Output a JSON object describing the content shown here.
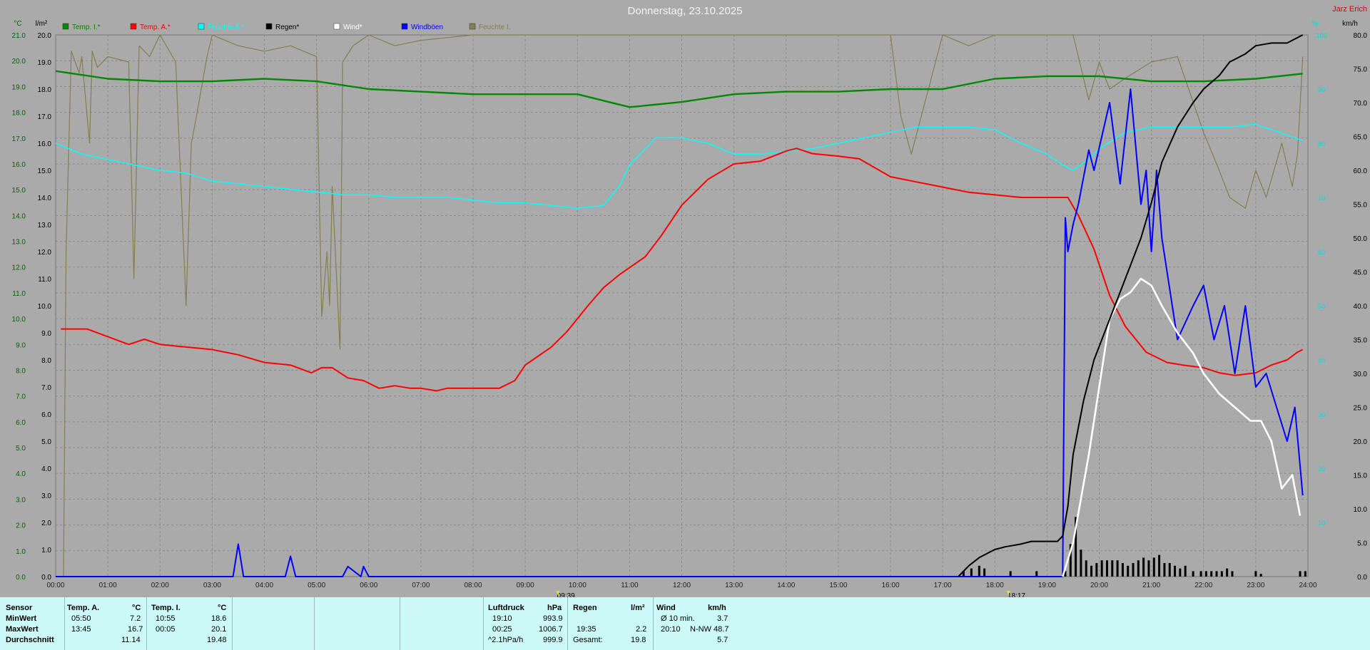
{
  "header": {
    "title": "Donnerstag, 23.10.2025",
    "station": "Jarz Erich"
  },
  "colors": {
    "background": "#aaaaaa",
    "grid": "#8c8c8c",
    "left_axis": "#008800",
    "right_axis": "#00dddd",
    "table_bg": "#ccfaf8"
  },
  "chart_data": {
    "type": "line",
    "axes": {
      "left_unit": "°C",
      "left2_unit": "l/m²",
      "right_unit": "km/h",
      "right2_unit": "%",
      "temp_ticks": [
        "21.0",
        "20.0",
        "19.0",
        "18.0",
        "17.0",
        "16.0",
        "15.0",
        "14.0",
        "13.0",
        "12.0",
        "11.0",
        "10.0",
        "9.0",
        "8.0",
        "7.0",
        "6.0",
        "5.0",
        "4.0",
        "3.0",
        "2.0",
        "1.0",
        "0.0"
      ],
      "rain_ticks": [
        "20.0",
        "19.0",
        "18.0",
        "17.0",
        "16.0",
        "15.0",
        "14.0",
        "13.0",
        "12.0",
        "11.0",
        "10.0",
        "9.0",
        "8.0",
        "7.0",
        "6.0",
        "5.0",
        "4.0",
        "3.0",
        "2.0",
        "1.0",
        "0.0"
      ],
      "wind_ticks": [
        "80.0",
        "75.0",
        "70.0",
        "65.0",
        "60.0",
        "55.0",
        "50.0",
        "45.0",
        "40.0",
        "35.0",
        "30.0",
        "25.0",
        "20.0",
        "15.0",
        "10.0",
        "5.0",
        "0.0"
      ],
      "humidity_ticks": [
        "100",
        "90",
        "80",
        "70",
        "60",
        "50",
        "40",
        "30",
        "20",
        "10"
      ],
      "x_ticks": [
        "00:00",
        "01:00",
        "02:00",
        "03:00",
        "04:00",
        "05:00",
        "06:00",
        "07:00",
        "08:00",
        "09:00",
        "10:00",
        "11:00",
        "12:00",
        "13:00",
        "14:00",
        "15:00",
        "16:00",
        "17:00",
        "18:00",
        "19:00",
        "20:00",
        "21:00",
        "22:00",
        "23:00",
        "24:00"
      ],
      "temp_range": [
        0,
        21
      ],
      "rain_range": [
        0,
        20
      ],
      "wind_range": [
        0,
        80
      ],
      "humidity_range": [
        0,
        100
      ],
      "x_range": [
        0,
        24
      ],
      "grid": true,
      "markers": [
        "09:39",
        "18:17"
      ]
    },
    "legend": [
      {
        "label": "Temp. I.*",
        "color": "#008800"
      },
      {
        "label": "Temp. A.*",
        "color": "#ff0000"
      },
      {
        "label": "Feuchte A.*",
        "color": "#00ffff"
      },
      {
        "label": "Regen*",
        "color": "#000000"
      },
      {
        "label": "Wind*",
        "color": "#ffffff"
      },
      {
        "label": "Windböen",
        "color": "#0000ff"
      },
      {
        "label": "Feuchte I.",
        "color": "#808050"
      }
    ],
    "series": [
      {
        "name": "Temp. I.*",
        "unit": "°C",
        "color": "#008800",
        "x": [
          0,
          1,
          2,
          3,
          4,
          5,
          6,
          7,
          8,
          9,
          10,
          11,
          12,
          13,
          14,
          15,
          16,
          17,
          18,
          19,
          20,
          21,
          22,
          23,
          23.9
        ],
        "y": [
          19.6,
          19.3,
          19.2,
          19.2,
          19.3,
          19.2,
          18.9,
          18.8,
          18.7,
          18.7,
          18.7,
          18.2,
          18.4,
          18.7,
          18.8,
          18.8,
          18.9,
          18.9,
          19.3,
          19.4,
          19.4,
          19.2,
          19.2,
          19.3,
          19.5
        ]
      },
      {
        "name": "Temp. A.*",
        "unit": "°C",
        "color": "#ff0000",
        "x": [
          0.1,
          0.6,
          1,
          1.4,
          1.7,
          2,
          2.5,
          3,
          3.5,
          4,
          4.5,
          4.9,
          5.1,
          5.3,
          5.6,
          5.9,
          6.2,
          6.5,
          6.8,
          7,
          7.3,
          7.5,
          8,
          8.5,
          8.8,
          9,
          9.5,
          9.8,
          10.2,
          10.5,
          10.8,
          11.3,
          11.6,
          12,
          12.5,
          13,
          13.5,
          14,
          14.2,
          14.5,
          15,
          15.4,
          16,
          16.5,
          17,
          17.5,
          18,
          18.5,
          19,
          19.4,
          19.6,
          19.9,
          20.2,
          20.5,
          20.9,
          21.3,
          21.6,
          22,
          22.3,
          22.6,
          23,
          23.3,
          23.6,
          23.8,
          23.9
        ],
        "y": [
          9.6,
          9.6,
          9.3,
          9.0,
          9.2,
          9.0,
          8.9,
          8.8,
          8.6,
          8.3,
          8.2,
          7.9,
          8.1,
          8.1,
          7.7,
          7.6,
          7.3,
          7.4,
          7.3,
          7.3,
          7.2,
          7.3,
          7.3,
          7.3,
          7.6,
          8.2,
          8.9,
          9.5,
          10.5,
          11.2,
          11.7,
          12.4,
          13.2,
          14.4,
          15.4,
          16.0,
          16.1,
          16.5,
          16.6,
          16.4,
          16.3,
          16.2,
          15.5,
          15.3,
          15.1,
          14.9,
          14.8,
          14.7,
          14.7,
          14.7,
          14.0,
          12.7,
          10.9,
          9.7,
          8.7,
          8.3,
          8.2,
          8.1,
          7.9,
          7.8,
          7.9,
          8.2,
          8.4,
          8.7,
          8.8
        ]
      },
      {
        "name": "Feuchte A.*",
        "unit": "%",
        "color": "#00ffff",
        "x": [
          0,
          0.5,
          1,
          1.5,
          2,
          2.5,
          3,
          3.5,
          4,
          4.5,
          5,
          5.5,
          6,
          6.5,
          7,
          7.5,
          8,
          8.5,
          9,
          9.5,
          10,
          10.5,
          10.8,
          11,
          11.5,
          12,
          12.5,
          13,
          13.5,
          14,
          14.5,
          15,
          15.5,
          16,
          16.5,
          17,
          17.5,
          18,
          18.5,
          19,
          19.3,
          19.5,
          19.8,
          20,
          20.5,
          21,
          21.5,
          22,
          22.5,
          23,
          23.3,
          23.6,
          23.9
        ],
        "y": [
          80,
          78,
          77,
          76,
          75,
          74.5,
          73,
          72.5,
          72,
          71.5,
          71,
          70.5,
          70.5,
          70,
          70,
          70,
          69.5,
          69,
          69,
          68.5,
          68,
          68.5,
          72,
          76,
          81,
          81,
          80,
          78,
          78,
          78.5,
          79,
          80,
          81,
          82,
          83,
          83,
          83,
          82.5,
          80,
          78,
          76,
          75,
          77,
          79,
          82,
          83,
          83,
          83,
          83,
          83.5,
          82.5,
          81.5,
          80.5
        ]
      },
      {
        "name": "Regen*",
        "unit": "l/m²",
        "color": "#000000",
        "x": [
          17.3,
          17.5,
          17.7,
          17.9,
          18,
          18.2,
          18.5,
          18.7,
          19,
          19.2,
          19.3,
          19.4,
          19.5,
          19.7,
          19.9,
          20.2,
          20.5,
          20.8,
          21,
          21.2,
          21.5,
          21.8,
          22,
          22.3,
          22.5,
          22.8,
          23,
          23.3,
          23.6,
          23.9
        ],
        "y": [
          0,
          0.4,
          0.7,
          0.9,
          1,
          1.1,
          1.2,
          1.3,
          1.3,
          1.3,
          1.5,
          2.6,
          4.5,
          6.5,
          8,
          9.5,
          11,
          12.5,
          13.8,
          15.3,
          16.6,
          17.5,
          18,
          18.5,
          19,
          19.3,
          19.6,
          19.7,
          19.7,
          20.0
        ]
      },
      {
        "name": "Wind*",
        "unit": "km/h",
        "color": "#ffffff",
        "x": [
          19.3,
          19.5,
          19.8,
          20,
          20.2,
          20.4,
          20.6,
          20.8,
          21,
          21.2,
          21.5,
          21.8,
          22,
          22.3,
          22.6,
          22.9,
          23.1,
          23.3,
          23.5,
          23.7,
          23.85
        ],
        "y": [
          0,
          5,
          18,
          28,
          38,
          41,
          42,
          44,
          43,
          40,
          36,
          33,
          30,
          27,
          25,
          23,
          23,
          20,
          13,
          15,
          9
        ]
      },
      {
        "name": "Windböen",
        "unit": "km/h",
        "color": "#0000ff",
        "x": [
          0,
          3.4,
          3.5,
          3.6,
          4.4,
          4.5,
          4.6,
          5.5,
          5.6,
          5.85,
          5.9,
          6,
          19.3,
          19.35,
          19.4,
          19.5,
          19.6,
          19.8,
          19.9,
          20.2,
          20.4,
          20.6,
          20.8,
          20.9,
          21,
          21.1,
          21.2,
          21.5,
          21.8,
          22,
          22.2,
          22.4,
          22.6,
          22.8,
          23,
          23.2,
          23.4,
          23.6,
          23.75,
          23.9
        ],
        "y": [
          0,
          0,
          4.8,
          0,
          0,
          3,
          0,
          0,
          1.5,
          0,
          1.5,
          0,
          0,
          53,
          48,
          52,
          55,
          63,
          60,
          70,
          58,
          72,
          55,
          60,
          48,
          60,
          50,
          35,
          40,
          43,
          35,
          40,
          30,
          40,
          28,
          30,
          25,
          20,
          25,
          12
        ]
      },
      {
        "name": "Feuchte I.",
        "unit": "%",
        "color": "#808050",
        "x": [
          0.15,
          0.2,
          0.3,
          0.45,
          0.5,
          0.65,
          0.7,
          0.8,
          1,
          1.4,
          1.5,
          1.6,
          1.8,
          2,
          2.3,
          2.5,
          2.6,
          2.7,
          2.9,
          3,
          3.5,
          4,
          4.5,
          5,
          5.1,
          5.2,
          5.25,
          5.3,
          5.45,
          5.5,
          5.7,
          6,
          6.5,
          7,
          8,
          9,
          10,
          11,
          12,
          13,
          14,
          15,
          16,
          16.2,
          16.4,
          17,
          17.5,
          18,
          19,
          19.5,
          19.8,
          20,
          20.2,
          20.5,
          21,
          21.5,
          22,
          22.3,
          22.5,
          22.8,
          23,
          23.2,
          23.5,
          23.7,
          23.8,
          23.9
        ],
        "y": [
          0,
          60,
          97,
          93,
          96,
          80,
          97,
          94,
          96,
          95,
          55,
          98,
          96,
          100,
          95,
          50,
          80,
          85,
          96,
          100,
          98,
          97,
          98,
          96,
          48,
          60,
          50,
          72,
          42,
          95,
          98,
          100,
          98,
          99,
          100,
          100,
          100,
          100,
          100,
          100,
          100,
          100,
          100,
          85,
          78,
          100,
          98,
          100,
          100,
          100,
          88,
          95,
          90,
          92,
          95,
          96,
          82,
          75,
          70,
          68,
          75,
          70,
          80,
          72,
          78,
          96
        ]
      }
    ],
    "rain_bars": {
      "unit": "l/m²",
      "x": [
        17.4,
        17.55,
        17.7,
        17.8,
        18.3,
        18.8,
        19.35,
        19.45,
        19.55,
        19.65,
        19.75,
        19.85,
        19.95,
        20.05,
        20.15,
        20.25,
        20.35,
        20.45,
        20.55,
        20.65,
        20.75,
        20.85,
        20.95,
        21.05,
        21.15,
        21.25,
        21.35,
        21.45,
        21.55,
        21.65,
        21.8,
        21.95,
        22.05,
        22.15,
        22.25,
        22.35,
        22.45,
        22.55,
        23.0,
        23.1,
        23.85,
        23.95
      ],
      "y": [
        0.2,
        0.3,
        0.4,
        0.3,
        0.2,
        0.2,
        0.2,
        1.2,
        2.2,
        1.0,
        0.6,
        0.4,
        0.5,
        0.6,
        0.6,
        0.6,
        0.6,
        0.5,
        0.4,
        0.5,
        0.6,
        0.7,
        0.6,
        0.7,
        0.8,
        0.5,
        0.5,
        0.4,
        0.3,
        0.4,
        0.2,
        0.2,
        0.2,
        0.2,
        0.2,
        0.2,
        0.3,
        0.2,
        0.2,
        0.1,
        0.2,
        0.2
      ]
    }
  },
  "stats": {
    "row_labels": [
      "Sensor",
      "MinWert",
      "MaxWert",
      "Durchschnitt"
    ],
    "temp_a": {
      "header": "Temp. A.",
      "unit": "°C",
      "min_time": "05:50",
      "min": "7.2",
      "max_time": "13:45",
      "max": "16.7",
      "avg": "11.14"
    },
    "temp_i": {
      "header": "Temp. I.",
      "unit": "°C",
      "min_time": "10:55",
      "min": "18.6",
      "max_time": "00:05",
      "max": "20.1",
      "avg": "19.48"
    },
    "pressure": {
      "header": "Luftdruck",
      "unit": "hPa",
      "min_time": "19:10",
      "min": "993.9",
      "max_time": "00:25",
      "max": "1006.7",
      "trend_label": "^2.1hPa/h",
      "trend": "999.9"
    },
    "rain": {
      "header": "Regen",
      "unit": "l/m²",
      "max_time": "19:35",
      "max": "2.2",
      "total_label": "Gesamt:",
      "total": "19.8"
    },
    "wind": {
      "header": "Wind",
      "unit": "km/h",
      "avg_label": "Ø 10 min.",
      "avg": "3.7",
      "max_time": "20:10",
      "max": "N-NW 48.7",
      "day_avg": "5.7"
    }
  }
}
